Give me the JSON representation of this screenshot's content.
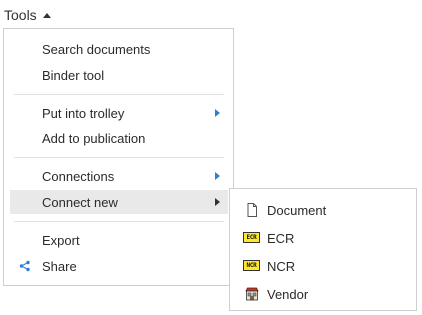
{
  "tools": {
    "label": "Tools"
  },
  "menu": {
    "search_documents": "Search documents",
    "binder_tool": "Binder tool",
    "put_into_trolley": "Put into trolley",
    "add_to_publication": "Add to publication",
    "connections": "Connections",
    "connect_new": "Connect new",
    "export": "Export",
    "share": "Share"
  },
  "submenu": {
    "document": "Document",
    "ecr": "ECR",
    "ncr": "NCR",
    "vendor": "Vendor",
    "ecr_icon": "ECR",
    "ncr_icon": "NCR"
  },
  "colors": {
    "submenu_arrow": "#2f7fd0",
    "active_bg": "#e9e9e9",
    "tag_yellow": "#ffe82a"
  },
  "icons": [
    "caret-up-icon",
    "chevron-right-icon",
    "share-icon",
    "document-icon",
    "ecr-icon",
    "ncr-icon",
    "vendor-icon"
  ]
}
